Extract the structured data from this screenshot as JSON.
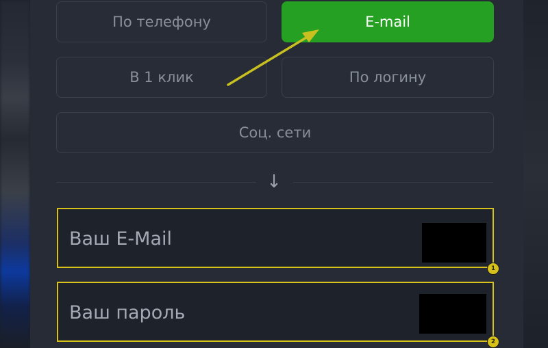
{
  "methods": {
    "phone_label": "По телефону",
    "email_label": "E-mail",
    "oneclick_label": "В 1 клик",
    "login_label": "По логину",
    "social_label": "Соц. сети"
  },
  "divider": {
    "icon": "arrow-down-icon",
    "glyph": "↓"
  },
  "form": {
    "email_placeholder": "Ваш E-Mail",
    "password_placeholder": "Ваш пароль"
  },
  "annotations": {
    "badge_1": "1",
    "badge_2": "2",
    "highlight_color": "#d8c21a",
    "arrow_color": "#c8c020"
  },
  "colors": {
    "accent_green": "#26a022",
    "panel_bg": "#262b35"
  }
}
